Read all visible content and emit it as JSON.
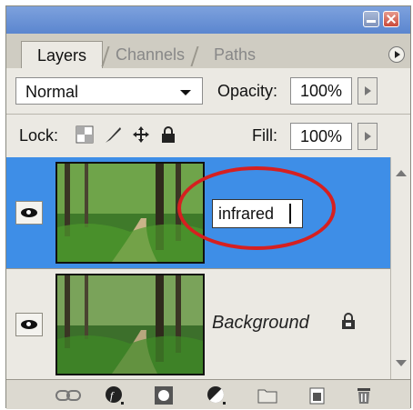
{
  "tabs": [
    {
      "label": "Layers",
      "active": true
    },
    {
      "label": "Channels",
      "active": false
    },
    {
      "label": "Paths",
      "active": false
    }
  ],
  "blend": {
    "mode": "Normal",
    "opacity_label": "Opacity:",
    "opacity_value": "100%"
  },
  "lock": {
    "label": "Lock:",
    "fill_label": "Fill:",
    "fill_value": "100%"
  },
  "layers": [
    {
      "name": "infrared",
      "editing": true,
      "selected": true,
      "visible": true
    },
    {
      "name": "Background",
      "locked": true,
      "selected": false,
      "visible": true
    }
  ],
  "colors": {
    "selection": "#3e8ee7",
    "annotation": "#d62020",
    "panel": "#ebe9e3"
  },
  "icons": [
    "link-icon",
    "layer-style-icon",
    "mask-icon",
    "adjustment-icon",
    "folder-icon",
    "new-layer-icon",
    "trash-icon"
  ]
}
